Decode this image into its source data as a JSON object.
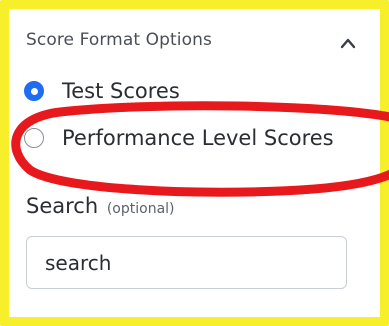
{
  "score_format": {
    "header": "Score Format Options",
    "collapse_icon": "chevron-up-icon",
    "options": [
      {
        "label": "Test Scores",
        "checked": true
      },
      {
        "label": "Performance Level Scores",
        "checked": false
      }
    ]
  },
  "search": {
    "label": "Search",
    "optional_label": "(optional)",
    "value": "search",
    "placeholder": "search"
  },
  "colors": {
    "frame_highlight": "#f6ef2a",
    "annotation_circle": "#e8191c",
    "radio_checked": "#1f6ef0"
  }
}
